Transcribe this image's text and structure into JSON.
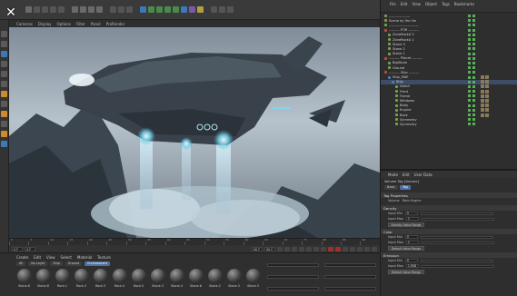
{
  "viewport_menu": [
    "Cameras",
    "Display",
    "Options",
    "Filter",
    "Panel",
    "ProRender"
  ],
  "object_manager": {
    "menu": [
      "File",
      "Edit",
      "View",
      "Object",
      "Tags",
      "Bookmarks"
    ],
    "items": [
      {
        "label": "------------------",
        "type": "green"
      },
      {
        "label": "Scene by Yan He",
        "type": "green"
      },
      {
        "label": "-------------------------",
        "type": "green"
      },
      {
        "label": "--------- FOR ---------",
        "type": "red"
      },
      {
        "label": "ZoneRockA 2",
        "type": "green"
      },
      {
        "label": "ZoneRockA 1",
        "type": "green"
      },
      {
        "label": "Stone 3",
        "type": "green"
      },
      {
        "label": "Stone 2",
        "type": "green"
      },
      {
        "label": "Stone 1",
        "type": "green"
      },
      {
        "label": "--------- Planet ---------",
        "type": "red"
      },
      {
        "label": "BigStone",
        "type": "green"
      },
      {
        "label": "Ground",
        "type": "green"
      },
      {
        "label": "--------- Ship ---------",
        "type": "red"
      },
      {
        "label": "Ship_MAE",
        "type": "blue"
      },
      {
        "label": "Ship",
        "type": "blue"
      },
      {
        "label": "Detail",
        "type": "green"
      },
      {
        "label": "Front",
        "type": "green"
      },
      {
        "label": "Frame",
        "type": "green"
      },
      {
        "label": "Windows",
        "type": "green"
      },
      {
        "label": "Body",
        "type": "green"
      },
      {
        "label": "Engine",
        "type": "green"
      },
      {
        "label": "Back",
        "type": "green"
      },
      {
        "label": "Symmetry",
        "type": "green"
      },
      {
        "label": "Symmetry",
        "type": "green"
      }
    ]
  },
  "attribute_manager": {
    "menu": [
      "Mode",
      "Edit",
      "User Data"
    ],
    "subtitle": "Volume Tag [Volume]",
    "tabs": [
      "Basic",
      "Tag"
    ],
    "active_tab": "Tag",
    "section_title": "Tag Properties",
    "properties": [
      {
        "label": "Volume",
        "value": "Main Engine"
      }
    ],
    "groups": [
      {
        "title": "Density",
        "rows": [
          {
            "label": "Input Min",
            "value": "0"
          },
          {
            "label": "Input Max",
            "value": "1"
          }
        ],
        "button": "Density Value Range"
      },
      {
        "title": "Color",
        "rows": [
          {
            "label": "Input Min",
            "value": "0"
          },
          {
            "label": "Input Max",
            "value": "1"
          }
        ],
        "button": "Default Value Range"
      },
      {
        "title": "Emission",
        "rows": [
          {
            "label": "Input Min",
            "value": "0"
          },
          {
            "label": "Input Max",
            "value": "1.908"
          }
        ],
        "button": "Default Value Range"
      }
    ]
  },
  "material_manager": {
    "menu": [
      "Create",
      "Edit",
      "View",
      "Select",
      "Material",
      "Texture"
    ],
    "tabs": [
      "All",
      "No Layer",
      "Ship",
      "Ground",
      "Environment"
    ],
    "active_tab": "Environment",
    "materials": [
      "Stone.8",
      "Stone.8",
      "Rock.1",
      "Rock.3",
      "Rock.3",
      "Rock.4",
      "Rock.5",
      "Stone.3",
      "Stone.4",
      "Stone.6",
      "Stone.2",
      "Stone.3",
      "Stone.3"
    ]
  },
  "timeline": {
    "ticks": [
      "0",
      "5",
      "10",
      "15",
      "20",
      "25",
      "30",
      "35",
      "40",
      "45",
      "50",
      "55",
      "60",
      "65",
      "70",
      "75",
      "80",
      "85",
      "90"
    ],
    "start": "0 F",
    "current": "0 F",
    "end": "90 F",
    "end2": "90 F"
  },
  "overlay": {
    "close": "✕",
    "next": "❯"
  },
  "colors": {
    "accent": "#4d6fa3",
    "record": "#a03030",
    "icon_orange": "#d08a2a"
  }
}
